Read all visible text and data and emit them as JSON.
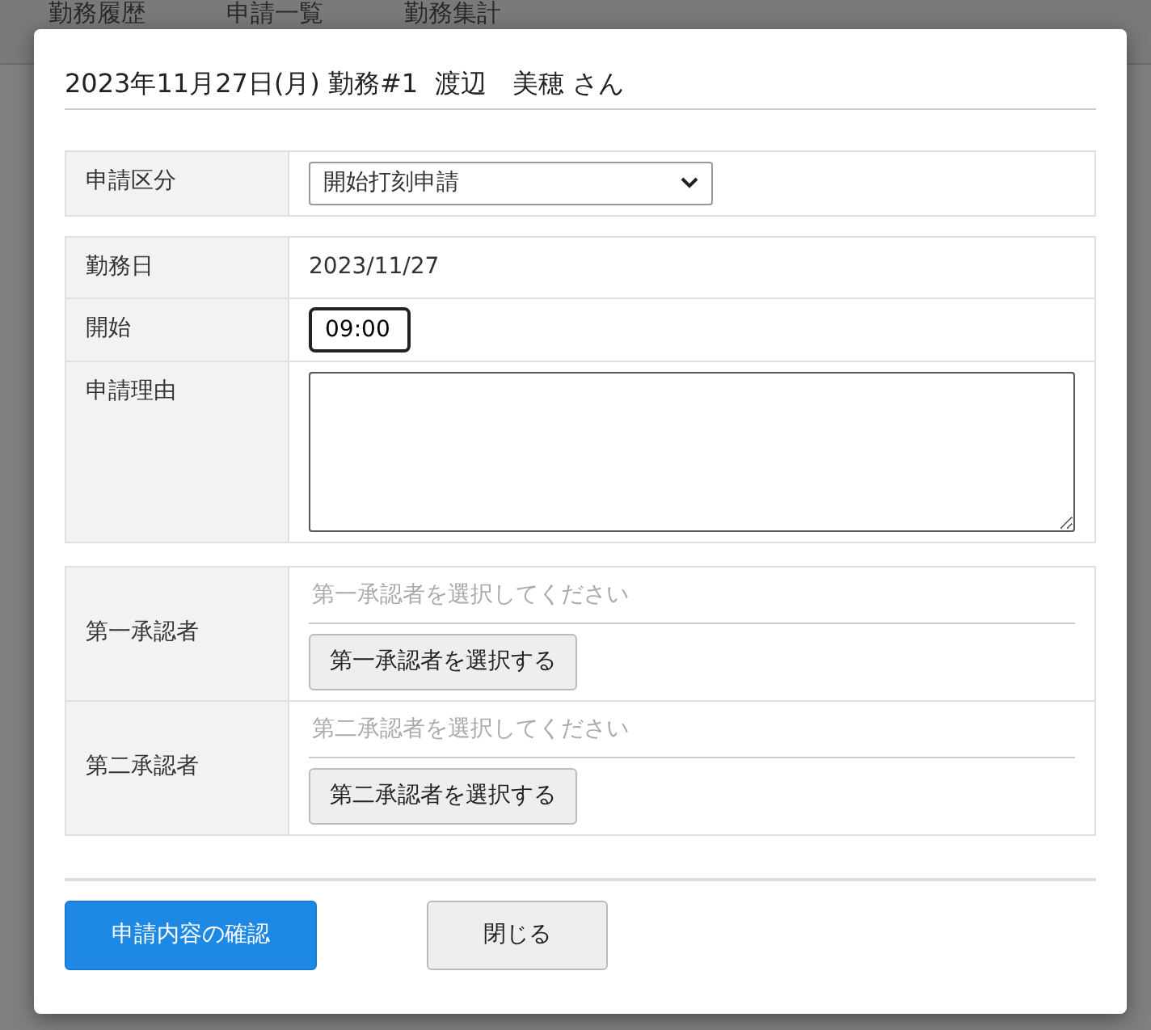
{
  "background_tabs": [
    "勤務履歴",
    "申請一覧",
    "勤務集計"
  ],
  "dialog": {
    "title": "2023年11月27日(月) 勤務#1  渡辺　美穂 さん",
    "request_type": {
      "label": "申請区分",
      "value": "開始打刻申請"
    },
    "details": [
      {
        "kind": "text",
        "label": "勤務日",
        "value": "2023/11/27"
      },
      {
        "kind": "time",
        "label": "開始",
        "value": "09:00",
        "focused": true
      },
      {
        "kind": "textarea",
        "label": "申請理由"
      }
    ],
    "approvers": [
      {
        "label": "第一承認者",
        "placeholder": "第一承認者を選択してください",
        "button": "第一承認者を選択する"
      },
      {
        "label": "第二承認者",
        "placeholder": "第二承認者を選択してください",
        "button": "第二承認者を選択する"
      }
    ],
    "buttons": [
      {
        "kind": "primary",
        "label": "申請内容の確認"
      },
      {
        "kind": "secondary",
        "label": "閉じる"
      }
    ]
  }
}
